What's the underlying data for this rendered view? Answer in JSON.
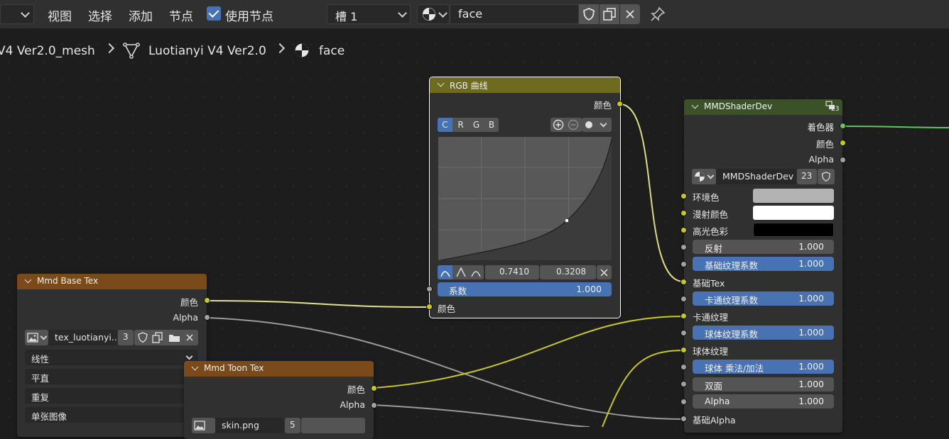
{
  "header": {
    "menus": [
      "视图",
      "选择",
      "添加",
      "节点"
    ],
    "use_nodes_label": "使用节点",
    "slot_label": "槽 1",
    "material_name": "face"
  },
  "breadcrumb": {
    "mesh": "V4 Ver2.0_mesh",
    "object": "Luotianyi V4 Ver2.0",
    "material": "face"
  },
  "rgb_curves": {
    "title": "RGB 曲线",
    "out_color": "颜色",
    "channels": [
      "C",
      "R",
      "G",
      "B"
    ],
    "point_x": "0.7410",
    "point_y": "0.3208",
    "factor_label": "系数",
    "factor_value": "1.000",
    "in_color": "颜色"
  },
  "mmd_shader": {
    "title": "MMDShaderDev",
    "users_badge": "23",
    "outputs": [
      "着色器",
      "颜色",
      "Alpha"
    ],
    "group_name": "MMDShaderDev",
    "group_users": "23",
    "inputs": {
      "ambient": "环境色",
      "diffuse": "漫射颜色",
      "specular": "高光色彩",
      "reflect_label": "反射",
      "reflect_value": "1.000",
      "base_tex_fac_label": "基础纹理系数",
      "base_tex_fac_value": "1.000",
      "base_tex": "基础Tex",
      "toon_tex_fac_label": "卡通纹理系数",
      "toon_tex_fac_value": "1.000",
      "toon_tex": "卡通纹理",
      "sphere_tex_fac_label": "球体纹理系数",
      "sphere_tex_fac_value": "1.000",
      "sphere_tex": "球体纹理",
      "sphere_mul_label": "球体 乘法/加法",
      "sphere_mul_value": "1.000",
      "double_sided_label": "双面",
      "double_sided_value": "1.000",
      "alpha_label": "Alpha",
      "alpha_value": "1.000",
      "base_alpha": "基础Alpha"
    },
    "colors": {
      "ambient": "#b3b3b3",
      "diffuse": "#ffffff",
      "specular": "#000000"
    }
  },
  "base_tex": {
    "title": "Mmd Base Tex",
    "out_color": "颜色",
    "out_alpha": "Alpha",
    "image_name": "tex_luotianyi...",
    "image_users": "3",
    "interpolation": "线性",
    "projection": "平直",
    "extension": "重复",
    "source": "单张图像"
  },
  "toon_tex": {
    "title": "Mmd Toon Tex",
    "out_color": "颜色",
    "out_alpha": "Alpha",
    "image_name": "skin.png",
    "image_users": "5"
  },
  "colors": {
    "header_bg": "#303030",
    "node_bg": "#303030",
    "curve_header": "#6e6a1f",
    "group_header": "#3b5228",
    "tex_header": "#7a4a1a",
    "accent": "#4772b3",
    "socket_yellow": "#c7c729",
    "socket_gray": "#a1a1a1",
    "socket_green": "#63c763"
  }
}
